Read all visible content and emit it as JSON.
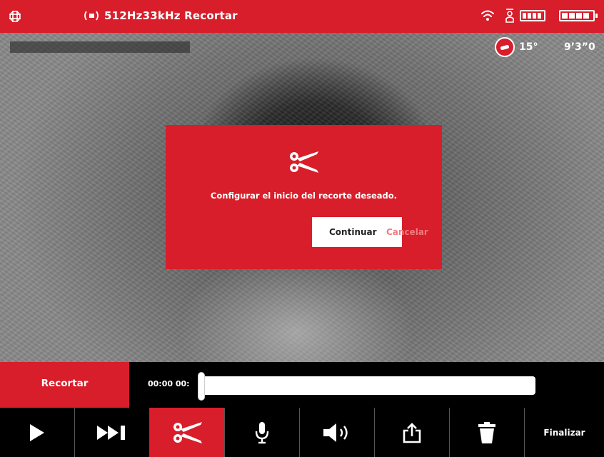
{
  "topbar": {
    "title": "512Hz33kHz Recortar",
    "icons": [
      "grid-icon",
      "locator-icon",
      "wifi-icon",
      "person-icon",
      "battery-icon",
      "battery-icon"
    ]
  },
  "overlay": {
    "tilt_value": "15°",
    "distance_value": "9’3”0"
  },
  "dialog": {
    "icon": "scissors-icon",
    "message": "Configurar el inicio del recorte deseado.",
    "continue_label": "Continuar",
    "cancel_label": "Cancelar"
  },
  "trim": {
    "tab_label": "Recortar",
    "time_label": "00:00 00:",
    "position": 0
  },
  "controls": {
    "finish_label": "Finalizar",
    "icons": [
      "play-icon",
      "skip-forward-icon",
      "scissors-icon",
      "microphone-icon",
      "volume-icon",
      "share-icon",
      "trash-icon"
    ]
  },
  "colors": {
    "accent": "#d81e2a",
    "cancel_text": "#f07a80",
    "bar_bg": "#000000"
  }
}
